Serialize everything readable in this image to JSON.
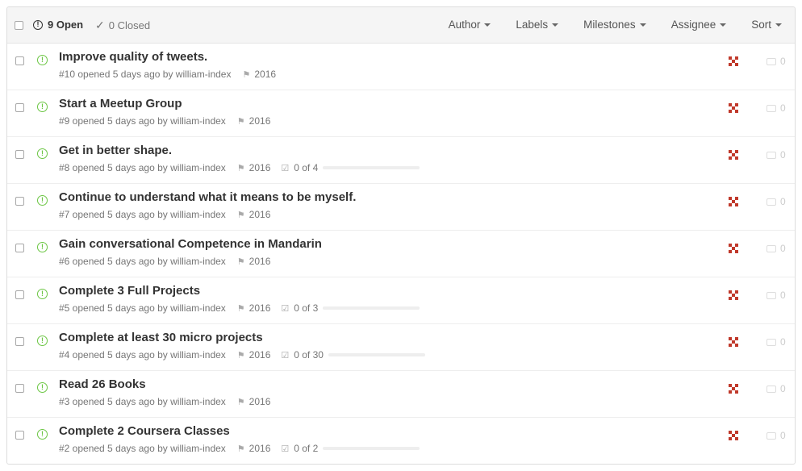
{
  "header": {
    "open_count": "9 Open",
    "closed_count": "0 Closed",
    "filters": [
      "Author",
      "Labels",
      "Milestones",
      "Assignee",
      "Sort"
    ]
  },
  "issues": [
    {
      "title": "Improve quality of tweets.",
      "meta": "#10 opened 5 days ago by william-index",
      "milestone": "2016",
      "tasks": null,
      "comments": "0"
    },
    {
      "title": "Start a Meetup Group",
      "meta": "#9 opened 5 days ago by william-index",
      "milestone": "2016",
      "tasks": null,
      "comments": "0"
    },
    {
      "title": "Get in better shape.",
      "meta": "#8 opened 5 days ago by william-index",
      "milestone": "2016",
      "tasks": "0 of 4",
      "comments": "0"
    },
    {
      "title": "Continue to understand what it means to be myself.",
      "meta": "#7 opened 5 days ago by william-index",
      "milestone": "2016",
      "tasks": null,
      "comments": "0"
    },
    {
      "title": "Gain conversational Competence in Mandarin",
      "meta": "#6 opened 5 days ago by william-index",
      "milestone": "2016",
      "tasks": null,
      "comments": "0"
    },
    {
      "title": "Complete 3 Full Projects",
      "meta": "#5 opened 5 days ago by william-index",
      "milestone": "2016",
      "tasks": "0 of 3",
      "comments": "0"
    },
    {
      "title": "Complete at least 30 micro projects",
      "meta": "#4 opened 5 days ago by william-index",
      "milestone": "2016",
      "tasks": "0 of 30",
      "comments": "0"
    },
    {
      "title": "Read 26 Books",
      "meta": "#3 opened 5 days ago by william-index",
      "milestone": "2016",
      "tasks": null,
      "comments": "0"
    },
    {
      "title": "Complete 2 Coursera Classes",
      "meta": "#2 opened 5 days ago by william-index",
      "milestone": "2016",
      "tasks": "0 of 2",
      "comments": "0"
    }
  ],
  "colors": {
    "open_green": "#6cc644",
    "avatar_red": "#c0392b"
  }
}
